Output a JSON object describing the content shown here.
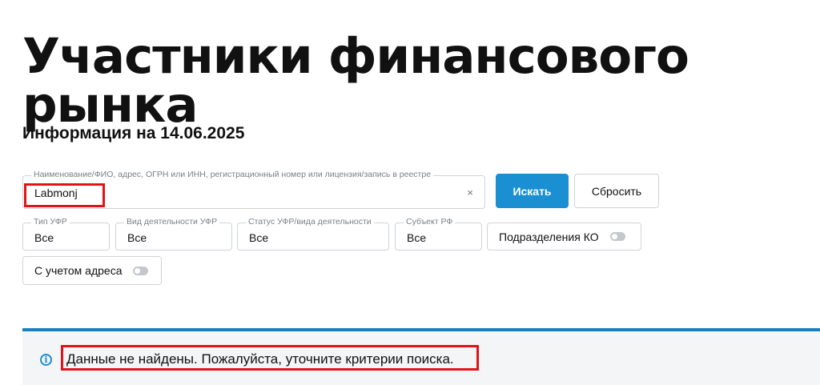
{
  "page": {
    "title": "Участники финансового рынка",
    "info_date": "Информация на 14.06.2025"
  },
  "search": {
    "label": "Наименование/ФИО, адрес, ОГРН или ИНН, регистрационный номер или лицензия/запись в реестре",
    "value": "Labmonj",
    "clear_icon": "close-icon",
    "clear_glyph": "×",
    "submit_label": "Искать",
    "reset_label": "Сбросить"
  },
  "filters": {
    "type": {
      "label": "Тип УФР",
      "value": "Все"
    },
    "activity": {
      "label": "Вид деятельности УФР",
      "value": "Все"
    },
    "status": {
      "label": "Статус УФР/вида деятельности",
      "value": "Все"
    },
    "region": {
      "label": "Субъект РФ",
      "value": "Все"
    },
    "ko_units": {
      "label": "Подразделения КО",
      "enabled": false
    },
    "address": {
      "label": "С учетом адреса",
      "enabled": false
    }
  },
  "notice": {
    "icon": "info-icon",
    "icon_glyph": "i",
    "text": "Данные не найдены. Пожалуйста, уточните критерии поиска."
  },
  "colors": {
    "primary": "#1a8fd1",
    "notice_border": "#1a7fbf",
    "highlight": "#e1131a"
  }
}
